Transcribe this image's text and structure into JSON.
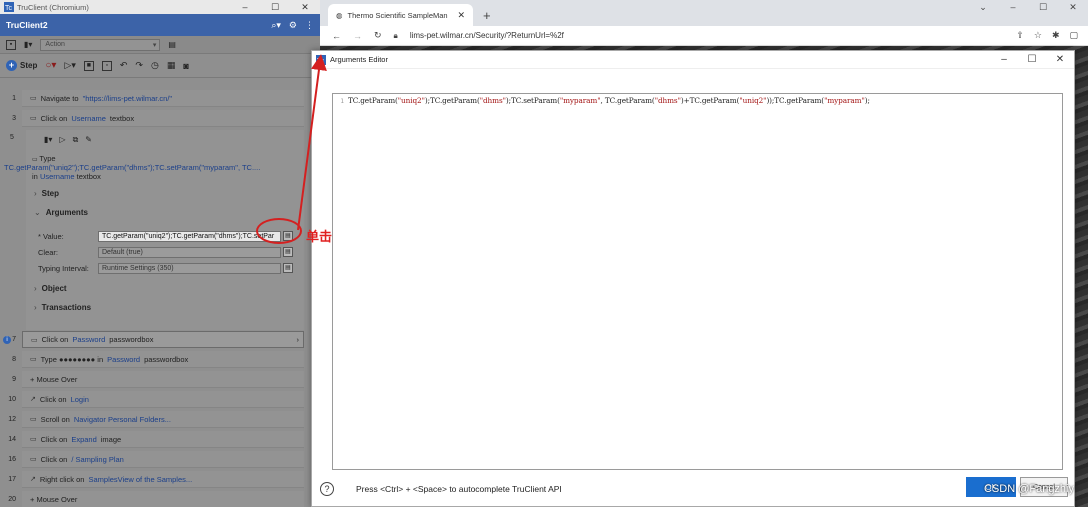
{
  "truclient": {
    "window_title": "TruClient (Chromium)",
    "app_name": "TruClient2",
    "action_placeholder": "Action",
    "step_button": "Step",
    "steps": [
      {
        "num": "1",
        "verb": "Navigate to",
        "object": "\"https://lims-pet.wilmar.cn/\"",
        "suffix": ""
      },
      {
        "num": "3",
        "verb": "Click on",
        "object": "Username",
        "suffix": "textbox"
      },
      {
        "num": "5",
        "verb": "",
        "object": "",
        "suffix": ""
      },
      {
        "num": "7",
        "verb": "Click on",
        "object": "Password",
        "suffix": "passwordbox"
      },
      {
        "num": "8",
        "verb": "Type ●●●●●●●● in",
        "object": "Password",
        "suffix": "passwordbox"
      },
      {
        "num": "9",
        "verb": "+ Mouse Over",
        "object": "",
        "suffix": ""
      },
      {
        "num": "10",
        "verb": "Click on",
        "object": "Login",
        "suffix": ""
      },
      {
        "num": "12",
        "verb": "Scroll on",
        "object": "Navigator Personal Folders...",
        "suffix": ""
      },
      {
        "num": "14",
        "verb": "Click on",
        "object": "Expand",
        "suffix": "image"
      },
      {
        "num": "16",
        "verb": "Click on",
        "object": "/ Sampling Plan",
        "suffix": ""
      },
      {
        "num": "17",
        "verb": "Right click on",
        "object": "SamplesView of the Samples...",
        "suffix": ""
      },
      {
        "num": "20",
        "verb": "+ Mouse Over",
        "object": "",
        "suffix": ""
      }
    ],
    "step5": {
      "type_label": "Type",
      "type_value": "TC.getParam(\"uniq2\");TC.getParam(\"dhms\");TC.setParam(\"myparam\", TC....",
      "in_label": "in",
      "object": "Username",
      "object_suffix": "textbox",
      "sections": {
        "step": "Step",
        "arguments": "Arguments",
        "object": "Object",
        "transactions": "Transactions"
      },
      "args": {
        "value_label": "* Value:",
        "value": "TC.getParam(\"uniq2\");TC.getParam(\"dhms\");TC.setPar",
        "clear_label": "Clear:",
        "clear_value": "Default (true)",
        "interval_label": "Typing Interval:",
        "interval_value": "Runtime Settings (350)"
      }
    },
    "annotation": "单击"
  },
  "browser": {
    "tab_title": "Thermo Scientific SampleMan",
    "url": "lims-pet.wilmar.cn/Security/?ReturnUrl=%2f"
  },
  "dialog": {
    "title": "Arguments Editor",
    "line_number": "1",
    "code": "TC.getParam(\"uniq2\");TC.getParam(\"dhms\");TC.setParam(\"myparam\", TC.getParam(\"dhms\")+TC.getParam(\"uniq2\"));TC.getParam(\"myparam\");",
    "hint": "Press <Ctrl> + <Space> to autocomplete TruClient API",
    "ok_label": "OK",
    "cancel_label": "Cancel",
    "help_icon": "?"
  },
  "watermark": "CSDN @Fangzhiy"
}
